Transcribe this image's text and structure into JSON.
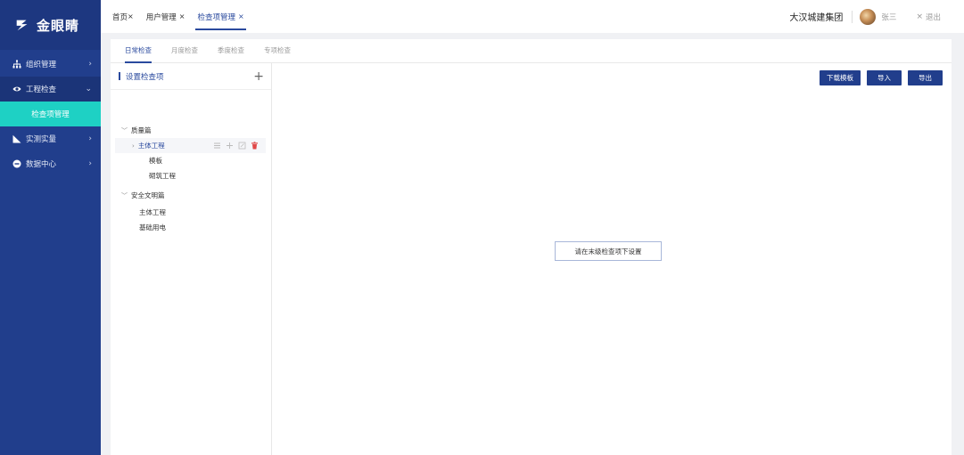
{
  "app": {
    "name": "金眼睛"
  },
  "sidebar": {
    "items": [
      {
        "label": "组织管理",
        "icon": "org-chart-icon",
        "arrow": "›"
      },
      {
        "label": "工程检查",
        "icon": "eye-icon",
        "arrow": "⌄"
      },
      {
        "label": "实测实量",
        "icon": "ruler-icon",
        "arrow": "›"
      },
      {
        "label": "数据中心",
        "icon": "data-icon",
        "arrow": "›"
      }
    ],
    "active_sub": "检查项管理"
  },
  "header": {
    "tabs": [
      {
        "label": "首页",
        "close": "×"
      },
      {
        "label": "用户管理",
        "close": "×"
      },
      {
        "label": "检查项管理",
        "close": "×"
      }
    ],
    "company": "大汉城建集团",
    "user": "张三",
    "logout": "退出",
    "logout_icon": "×"
  },
  "subtabs": [
    "日常检查",
    "月度检查",
    "季度检查",
    "专项检查"
  ],
  "left_panel": {
    "title": "设置检查项",
    "add_icon": "+",
    "tree": [
      {
        "label": "质量篇",
        "caret": "﹀"
      },
      {
        "label": "主体工程",
        "caret": "›"
      },
      {
        "label": "模板",
        "caret": ""
      },
      {
        "label": "砌筑工程",
        "caret": ""
      },
      {
        "label": "安全文明篇",
        "caret": "﹀"
      },
      {
        "label": "主体工程",
        "caret": ""
      },
      {
        "label": "基础用电",
        "caret": ""
      }
    ]
  },
  "toolbar": {
    "download": "下载模板",
    "import": "导入",
    "export": "导出"
  },
  "hint": "请在末级检查项下设置",
  "colors": {
    "sidebar": "#213e8c",
    "accent": "#2a4a9e",
    "submenu_active": "#1ed1c4",
    "delete": "#e04848"
  }
}
